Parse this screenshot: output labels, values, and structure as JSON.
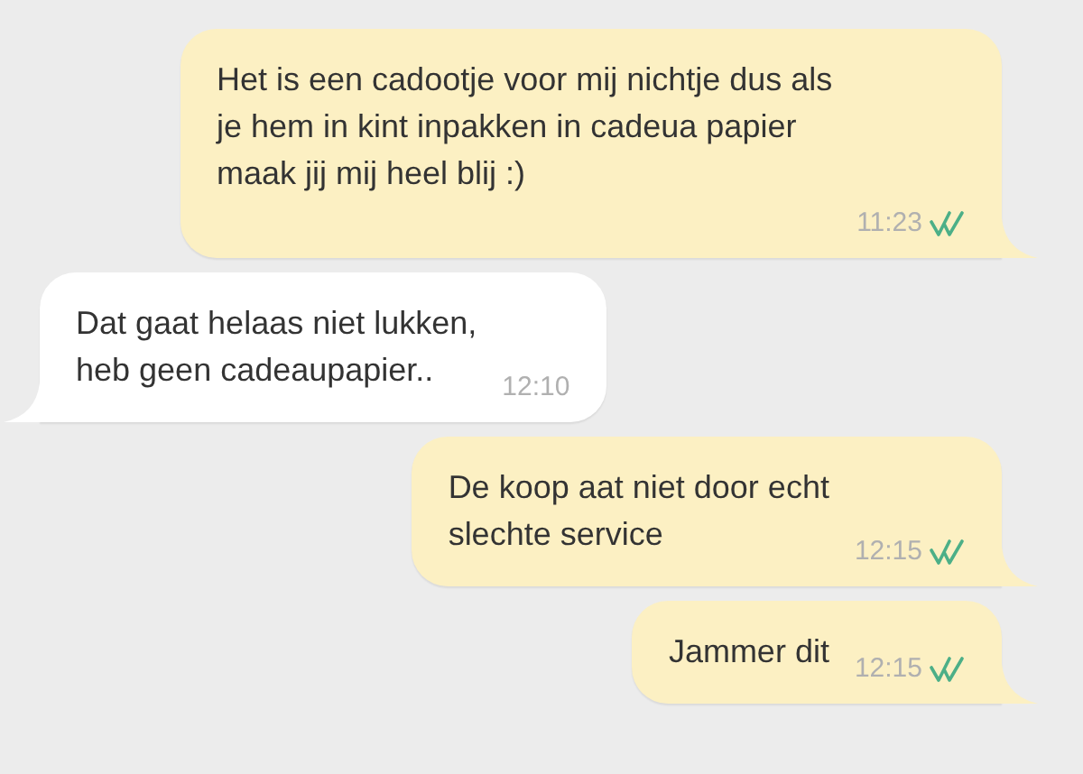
{
  "messages": [
    {
      "kind": "outgoing",
      "text": "Het is een cadootje voor mij nichtje dus als\nje hem in kint inpakken in cadeua papier\nmaak jij mij heel blij :)",
      "time": "11:23",
      "read": true
    },
    {
      "kind": "incoming",
      "text": "Dat gaat helaas niet lukken,\nheb geen cadeaupapier..",
      "time": "12:10"
    },
    {
      "kind": "outgoing",
      "text": "De koop aat niet door echt\nslechte service",
      "time": "12:15",
      "read": true
    },
    {
      "kind": "outgoing",
      "text": "Jammer dit",
      "time": "12:15",
      "read": true
    }
  ]
}
